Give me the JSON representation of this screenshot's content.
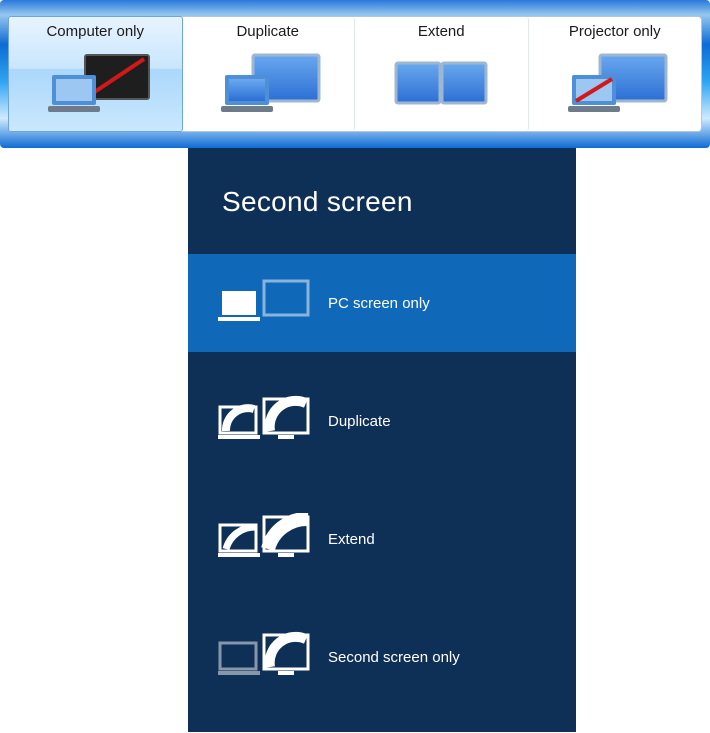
{
  "win7": {
    "items": [
      {
        "label": "Computer only",
        "selected": true
      },
      {
        "label": "Duplicate",
        "selected": false
      },
      {
        "label": "Extend",
        "selected": false
      },
      {
        "label": "Projector only",
        "selected": false
      }
    ]
  },
  "metro": {
    "title": "Second screen",
    "items": [
      {
        "label": "PC screen only",
        "selected": true
      },
      {
        "label": "Duplicate",
        "selected": false
      },
      {
        "label": "Extend",
        "selected": false
      },
      {
        "label": "Second screen only",
        "selected": false
      }
    ]
  }
}
